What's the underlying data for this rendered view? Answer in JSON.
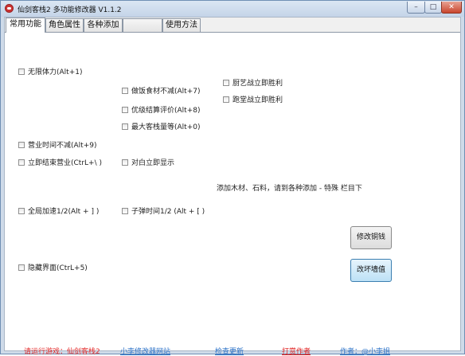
{
  "window": {
    "title": "仙剑客栈2 多功能修改器 V1.1.2",
    "controls": {
      "minimize": "–",
      "maximize": "□",
      "close": "✕"
    }
  },
  "tabs": [
    {
      "label": "常用功能",
      "active": true
    },
    {
      "label": "角色属性",
      "active": false
    },
    {
      "label": "各种添加",
      "active": false
    },
    {
      "label": "",
      "active": false
    },
    {
      "label": "使用方法",
      "active": false
    }
  ],
  "options": {
    "infinite_stamina": "无限体力(Alt+1)",
    "cooking_no_decrease": "做饭食材不减(Alt+7)",
    "cooking_battle_win": "厨艺战立即胜利",
    "palm_battle_win": "跑堂战立即胜利",
    "best_review": "优级结算评价(Alt+8)",
    "max_guests": "最大客栈量等(Alt+0)",
    "business_time_fixed": "营业时间不减(Alt+9)",
    "end_business_now": "立即结束营业(CtrL+\\ )",
    "show_dialog_now": "对白立即显示",
    "global_speed_half": "全局加速1/2(Alt + ] )",
    "bullet_time_half": "子弹时间1/2 (Alt + [ )",
    "hide_ui": "隐藏界面(CtrL+5)"
  },
  "note": "添加木材、石料，请到各种添加 - 特殊 栏目下",
  "buttons": {
    "modify_money": "修改铜钱",
    "change_value": "改坏墙值"
  },
  "footer": {
    "run_game": "请运行游戏：仙剑客栈2",
    "site": "小李修改器网站",
    "check_update": "检查更新",
    "tip_author": "打赏作者",
    "author": "作者：@小李姐"
  },
  "colors": {
    "run_game": "#e22a2a",
    "site": "#2f74c8",
    "check_update": "#2f74c8",
    "tip_author": "#e02020",
    "author": "#2f74c8"
  }
}
